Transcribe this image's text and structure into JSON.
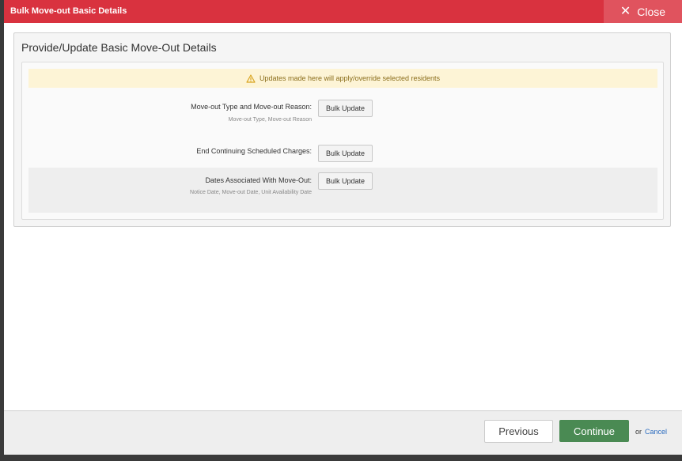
{
  "window": {
    "title": "Bulk Move-out Basic Details",
    "close_label": "Close",
    "close_icon": "close-icon",
    "accent_color": "#d9323f"
  },
  "panel": {
    "title": "Provide/Update Basic Move-Out Details",
    "warning": {
      "icon": "warning-icon",
      "text": "Updates made here will apply/override selected residents",
      "color": "#fdf4d6"
    },
    "rows": [
      {
        "label": "Move-out Type and Move-out Reason:",
        "sub": "Move-out Type, Move-out Reason",
        "button": "Bulk Update"
      },
      {
        "label": "End Continuing Scheduled Charges:",
        "sub": "",
        "button": "Bulk Update"
      },
      {
        "label": "Dates Associated With Move-Out:",
        "sub": "Notice Date, Move-out Date, Unit Availability Date",
        "button": "Bulk Update"
      }
    ]
  },
  "footer": {
    "previous_label": "Previous",
    "continue_label": "Continue",
    "continue_color": "#4a8a53",
    "or_text": "or",
    "cancel_label": "Cancel"
  }
}
